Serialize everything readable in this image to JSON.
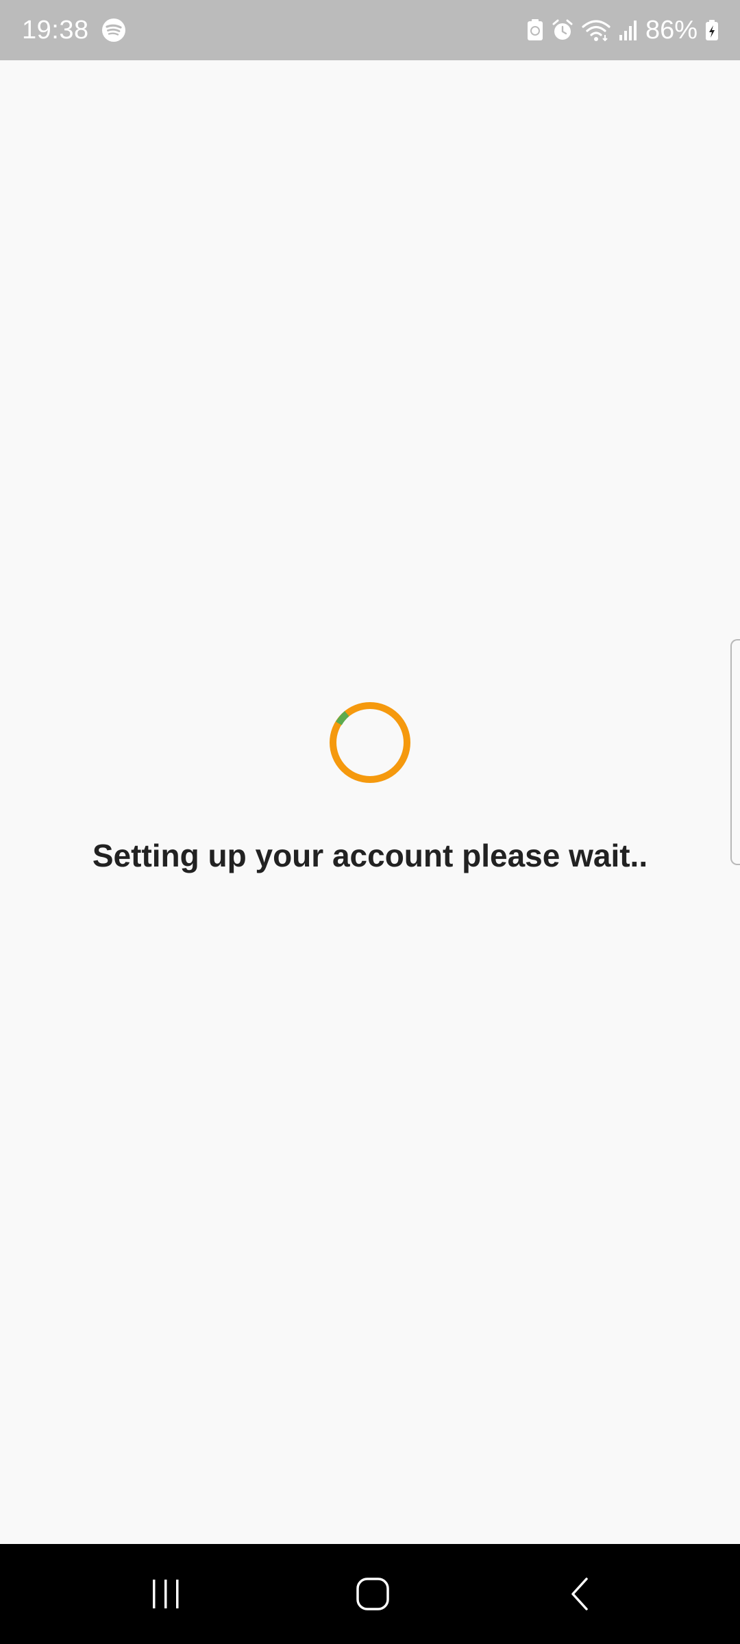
{
  "status_bar": {
    "time": "19:38",
    "battery_percent": "86%",
    "icons": [
      "spotify-icon",
      "battery-saver-icon",
      "alarm-icon",
      "wifi-icon",
      "signal-icon",
      "battery-charging-icon"
    ]
  },
  "main": {
    "loading_message": "Setting up your account please wait..",
    "spinner": {
      "color_primary": "#f5990e",
      "color_accent": "#5cab4f"
    }
  },
  "nav_bar": {
    "buttons": [
      "recents-icon",
      "home-icon",
      "back-icon"
    ]
  }
}
